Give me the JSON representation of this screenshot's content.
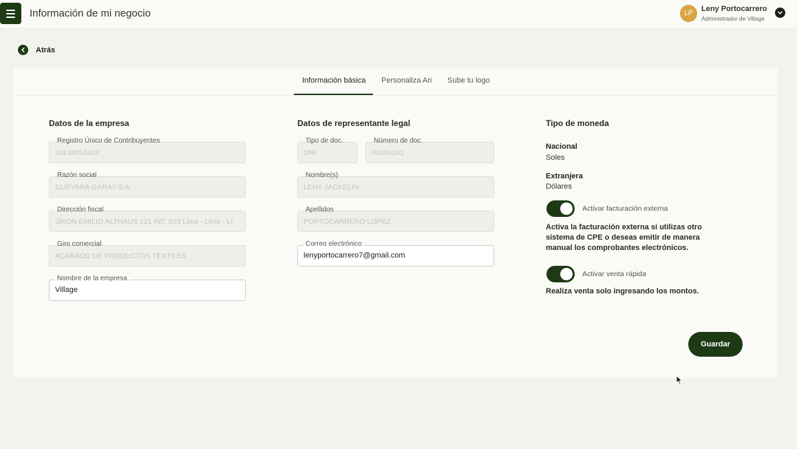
{
  "header": {
    "title": "Información de mi negocio",
    "user": {
      "initials": "LP",
      "name": "Leny Portocarrero",
      "role": "Administrador de Village"
    }
  },
  "nav": {
    "back_label": "Atrás"
  },
  "tabs": [
    {
      "label": "Información básica",
      "active": true
    },
    {
      "label": "Personaliza Ari",
      "active": false
    },
    {
      "label": "Sube tu logo",
      "active": false
    }
  ],
  "company": {
    "title": "Datos de la empresa",
    "ruc": {
      "label": "Registro Único de Contribuyentes",
      "value": "20138053424"
    },
    "razon_social": {
      "label": "Razón social",
      "value": "GUEVARA GARAY S.A."
    },
    "direccion": {
      "label": "Dirección fiscal",
      "value": "JIRÓN EMILIO ALTHAUS 121 INT. 603 Lima - Lima - LI"
    },
    "giro": {
      "label": "Giro comercial",
      "value": "ACABADO DE PRODUCTOS TEXTILES"
    },
    "nombre": {
      "label": "Nombre de la empresa",
      "value": "Village"
    }
  },
  "legal_rep": {
    "title": "Datos de representante legal",
    "tipo_doc": {
      "label": "Tipo de doc.",
      "value": "DNI"
    },
    "num_doc": {
      "label": "Número de doc.",
      "value": "46385261"
    },
    "nombres": {
      "label": "Nombre(s)",
      "value": "LENY JACKELIN"
    },
    "apellidos": {
      "label": "Apellidos",
      "value": "PORTOCARRERO LOPEZ"
    },
    "correo": {
      "label": "Correo electrónico",
      "value": "lenyportocarrero7@gmail.com"
    }
  },
  "currency": {
    "title": "Tipo de moneda",
    "nacional_label": "Nacional",
    "nacional_value": "Soles",
    "extranjera_label": "Extranjera",
    "extranjera_value": "Dólares"
  },
  "toggles": {
    "facturacion": {
      "label": "Activar facturación externa",
      "on": true,
      "desc_line1": "Activa la facturación externa si utilizas otro",
      "desc_line2": "sistema de CPE o deseas emitir de manera",
      "desc_line3": "manual los comprobantes electrónicos."
    },
    "venta_rapida": {
      "label": "Activar venta rápida",
      "on": true,
      "desc": "Realiza venta solo ingresando los montos."
    }
  },
  "actions": {
    "save_label": "Guardar"
  },
  "colors": {
    "primary": "#1d3a14",
    "avatar": "#d9a644",
    "background": "#f2f2ee",
    "card": "#fafaf6"
  }
}
